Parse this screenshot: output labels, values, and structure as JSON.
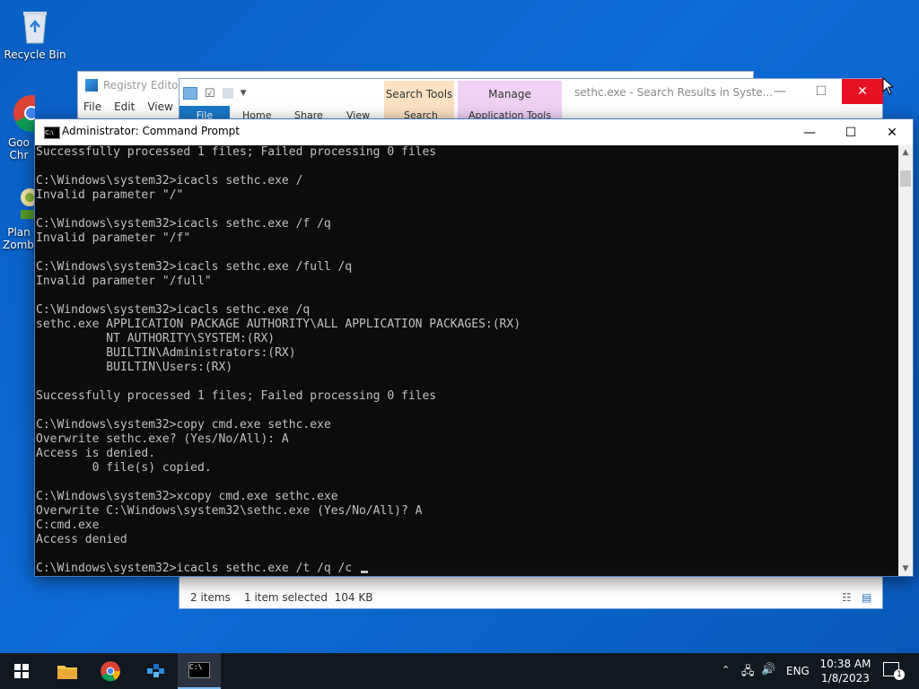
{
  "desktop": {
    "icons": [
      {
        "label": "Recycle Bin",
        "icon": "recycle-bin-icon"
      },
      {
        "label": "Goo Chr",
        "icon": "chrome-icon"
      },
      {
        "label": "Plan Zombi",
        "icon": "plants-zombies-icon"
      }
    ]
  },
  "regedit": {
    "title": "Registry Editor",
    "menu": [
      "File",
      "Edit",
      "View"
    ]
  },
  "explorer": {
    "title": "sethc.exe - Search Results in Syste...",
    "context_search": "Search Tools",
    "context_manage": "Manage",
    "tabs": [
      "File",
      "Home",
      "Share",
      "View",
      "Search",
      "Application Tools"
    ],
    "status": {
      "items": "2 items",
      "selected": "1 item selected  104 KB"
    }
  },
  "cmd": {
    "title": "Administrator: Command Prompt",
    "lines": [
      "Successfully processed 1 files; Failed processing 0 files",
      "",
      "C:\\Windows\\system32>icacls sethc.exe /",
      "Invalid parameter \"/\"",
      "",
      "C:\\Windows\\system32>icacls sethc.exe /f /q",
      "Invalid parameter \"/f\"",
      "",
      "C:\\Windows\\system32>icacls sethc.exe /full /q",
      "Invalid parameter \"/full\"",
      "",
      "C:\\Windows\\system32>icacls sethc.exe /q",
      "sethc.exe APPLICATION PACKAGE AUTHORITY\\ALL APPLICATION PACKAGES:(RX)",
      "          NT AUTHORITY\\SYSTEM:(RX)",
      "          BUILTIN\\Administrators:(RX)",
      "          BUILTIN\\Users:(RX)",
      "",
      "Successfully processed 1 files; Failed processing 0 files",
      "",
      "C:\\Windows\\system32>copy cmd.exe sethc.exe",
      "Overwrite sethc.exe? (Yes/No/All): A",
      "Access is denied.",
      "        0 file(s) copied.",
      "",
      "C:\\Windows\\system32>xcopy cmd.exe sethc.exe",
      "Overwrite C:\\Windows\\system32\\sethc.exe (Yes/No/All)? A",
      "C:cmd.exe",
      "Access denied",
      "",
      "C:\\Windows\\system32>icacls sethc.exe /t /q /c "
    ]
  },
  "taskbar": {
    "apps": [
      "file-explorer-icon",
      "chrome-icon",
      "regedit-icon",
      "command-prompt-icon"
    ],
    "language": "ENG",
    "time": "10:38 AM",
    "date": "1/8/2023",
    "notification_count": "1"
  }
}
